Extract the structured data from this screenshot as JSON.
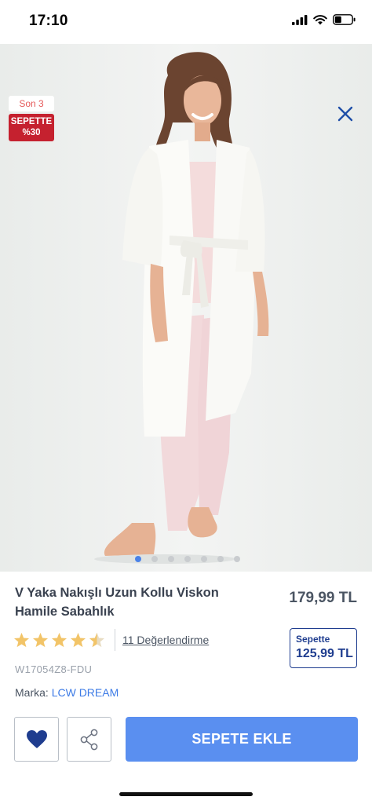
{
  "status_bar": {
    "time": "17:10"
  },
  "hero": {
    "stock_badge": "Son 3",
    "promo_line1": "SEPETTE",
    "promo_line2": "%30",
    "image_count": 7,
    "active_image": 1
  },
  "product": {
    "title": "V Yaka Nakışlı Uzun Kollu Viskon Hamile Sabahlık",
    "price": "179,99 TL",
    "basket_label": "Sepette",
    "basket_price": "125,99 TL",
    "rating": 4.5,
    "reviews_label": "11 Değerlendirme",
    "sku": "W17054Z8-FDU",
    "brand_label": "Marka:",
    "brand_name": "LCW DREAM"
  },
  "actions": {
    "add_to_cart": "SEPETE EKLE"
  },
  "colors": {
    "accent": "#5a8ff0",
    "promo": "#c5212f",
    "basket_border": "#1f3d8f",
    "star": "#f2c468"
  }
}
